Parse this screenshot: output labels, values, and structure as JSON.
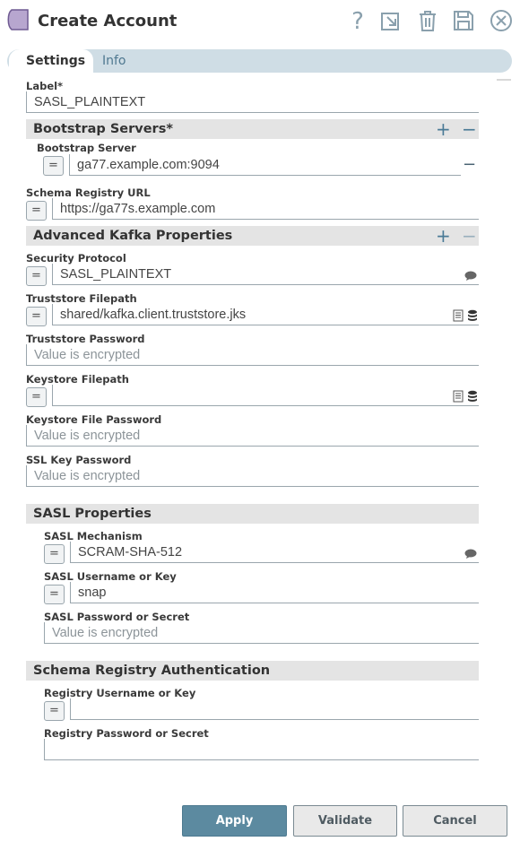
{
  "header": {
    "title": "Create Account",
    "icons": [
      "help-icon",
      "export-icon",
      "delete-icon",
      "save-icon",
      "close-icon"
    ]
  },
  "tabs": [
    {
      "label": "Settings",
      "active": true
    },
    {
      "label": "Info",
      "active": false
    }
  ],
  "fields": {
    "label": {
      "label": "Label*",
      "value": "SASL_PLAINTEXT"
    },
    "bootstrap_section": "Bootstrap Servers*",
    "bootstrap_server": {
      "label": "Bootstrap Server",
      "value": "ga77",
      "value_tail": ".example.com:9094"
    },
    "schema_registry_url": {
      "label": "Schema Registry URL",
      "value": "https://ga77s",
      "value_tail": ".example.com"
    },
    "advanced_section": "Advanced Kafka Properties",
    "security_protocol": {
      "label": "Security Protocol",
      "value": "SASL_PLAINTEXT"
    },
    "truststore_filepath": {
      "label": "Truststore Filepath",
      "value": "shared/kafka.client.truststore.jks"
    },
    "truststore_password": {
      "label": "Truststore Password",
      "placeholder": "Value is encrypted"
    },
    "keystore_filepath": {
      "label": "Keystore Filepath",
      "value": ""
    },
    "keystore_file_password": {
      "label": "Keystore File Password",
      "placeholder": "Value is encrypted"
    },
    "ssl_key_password": {
      "label": "SSL Key Password",
      "placeholder": "Value is encrypted"
    },
    "sasl_section": "SASL Properties",
    "sasl_mechanism": {
      "label": "SASL Mechanism",
      "value": "SCRAM-SHA-512"
    },
    "sasl_username": {
      "label": "SASL Username or Key",
      "value": "snap"
    },
    "sasl_password": {
      "label": "SASL Password or Secret",
      "placeholder": "Value is encrypted"
    },
    "schema_auth_section": "Schema Registry Authentication",
    "registry_username": {
      "label": "Registry Username or Key",
      "value": ""
    },
    "registry_password": {
      "label": "Registry Password or Secret",
      "value": ""
    }
  },
  "buttons": {
    "apply": "Apply",
    "validate": "Validate",
    "cancel": "Cancel"
  },
  "symbols": {
    "eq": "=",
    "plus": "+",
    "minus": "−"
  },
  "colors": {
    "accent": "#5c8aa0",
    "tabbar": "#cfdde5",
    "section": "#e4e4e4"
  }
}
